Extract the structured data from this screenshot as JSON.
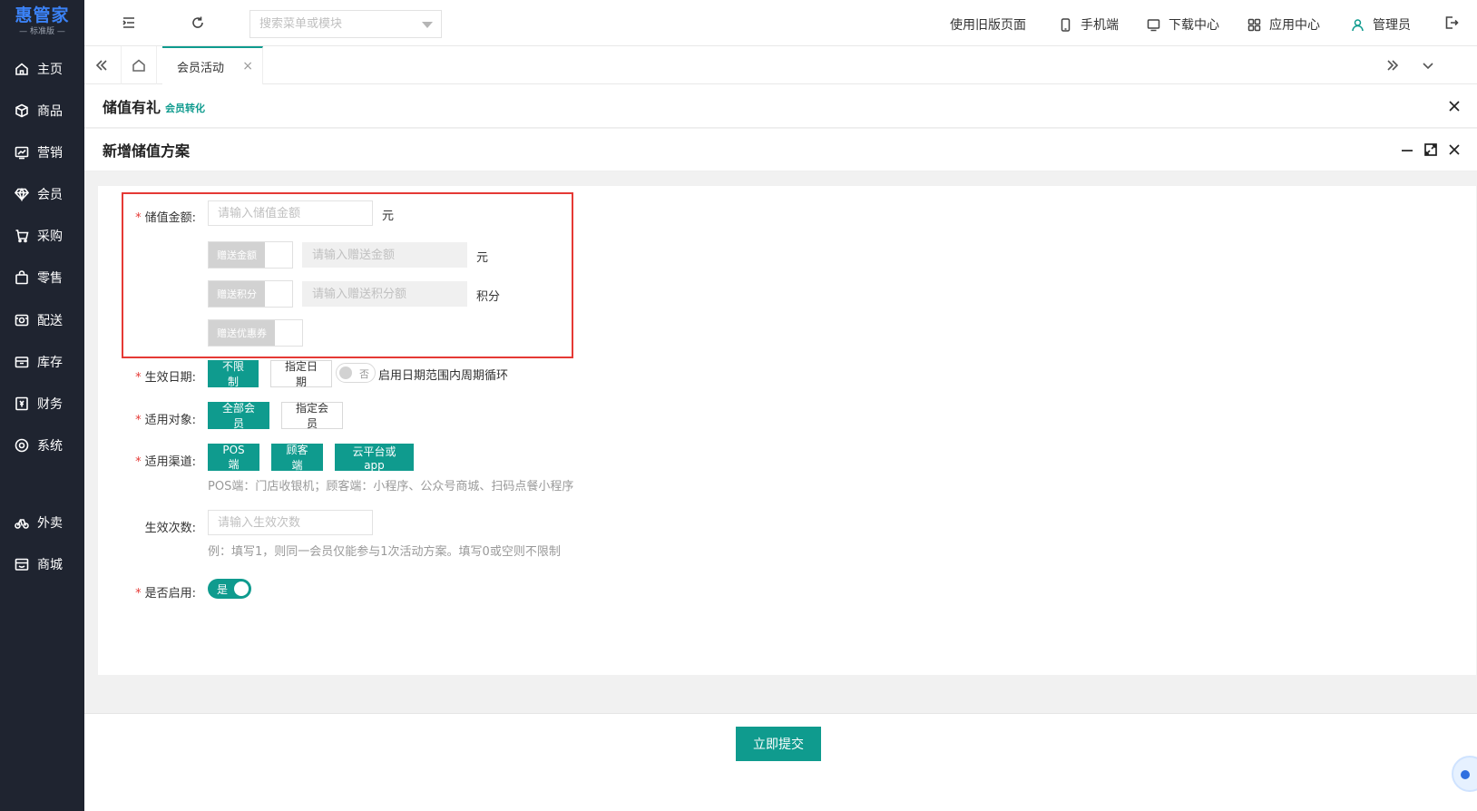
{
  "logo": {
    "main": "惠管家",
    "sub": "— 标准版 —"
  },
  "sidebar": {
    "items": [
      {
        "label": "主页",
        "icon": "home-icon"
      },
      {
        "label": "商品",
        "icon": "box-icon"
      },
      {
        "label": "营销",
        "icon": "chart-icon"
      },
      {
        "label": "会员",
        "icon": "diamond-icon"
      },
      {
        "label": "采购",
        "icon": "cart-icon"
      },
      {
        "label": "零售",
        "icon": "bag-icon"
      },
      {
        "label": "配送",
        "icon": "truck-icon"
      },
      {
        "label": "库存",
        "icon": "inventory-icon"
      },
      {
        "label": "财务",
        "icon": "finance-icon"
      },
      {
        "label": "系统",
        "icon": "system-icon"
      },
      {
        "label": "外卖",
        "icon": "bike-icon"
      },
      {
        "label": "商城",
        "icon": "store-icon"
      }
    ]
  },
  "topbar": {
    "search_placeholder": "搜索菜单或模块",
    "old_page": "使用旧版页面",
    "mobile": "手机端",
    "download": "下载中心",
    "apps": "应用中心",
    "user": "管理员"
  },
  "tabs": [
    {
      "label": "会员活动",
      "close": "×"
    }
  ],
  "section1": {
    "title": "储值有礼",
    "tag": "会员转化"
  },
  "section2": {
    "title": "新增储值方案"
  },
  "form": {
    "amount": {
      "label": "储值金额:",
      "placeholder": "请输入储值金额",
      "unit": "元"
    },
    "gift_amount": {
      "switch_label": "赠送金额",
      "placeholder": "请输入赠送金额",
      "unit": "元"
    },
    "gift_points": {
      "switch_label": "赠送积分",
      "placeholder": "请输入赠送积分额",
      "unit": "积分"
    },
    "gift_coupon": {
      "switch_label": "赠送优惠券"
    },
    "date": {
      "label": "生效日期:",
      "opt_unlimited": "不限制",
      "opt_specify": "指定日期",
      "toggle_text": "否",
      "cycle_text": "启用日期范围内周期循环"
    },
    "target": {
      "label": "适用对象:",
      "opt_all": "全部会员",
      "opt_specify": "指定会员"
    },
    "channel": {
      "label": "适用渠道:",
      "opt_pos": "POS端",
      "opt_customer": "顾客端",
      "opt_cloud": "云平台或app",
      "hint": "POS端：门店收银机；顾客端：小程序、公众号商城、扫码点餐小程序"
    },
    "times": {
      "label": "生效次数:",
      "placeholder": "请输入生效次数",
      "hint": "例：填写1，则同一会员仅能参与1次活动方案。填写0或空则不限制"
    },
    "enabled": {
      "label": "是否启用:",
      "toggle_text": "是"
    },
    "required_mark": "*"
  },
  "footer": {
    "submit": "立即提交"
  },
  "colors": {
    "primary": "#0f9b8e",
    "sidebar": "#1f2430",
    "highlight": "#e53935"
  }
}
